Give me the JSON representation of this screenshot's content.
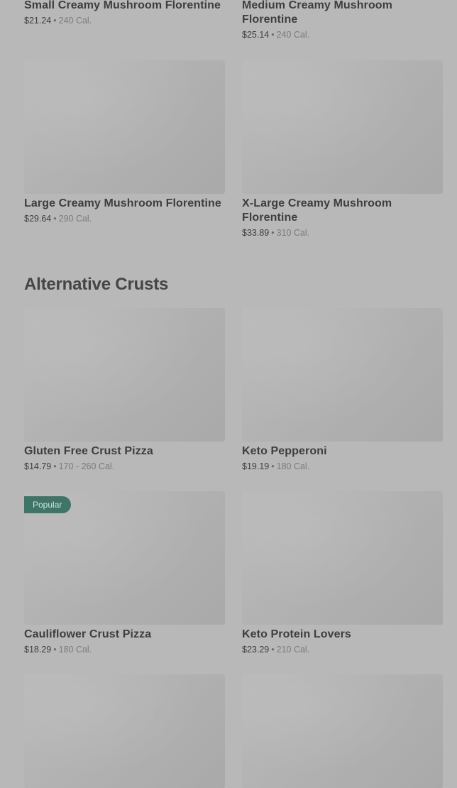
{
  "top_items": [
    {
      "name": "Small Creamy Mushroom Florentine",
      "price": "$21.24",
      "calories": "240 Cal."
    },
    {
      "name": "Medium Creamy Mushroom Florentine",
      "price": "$25.14",
      "calories": "240 Cal."
    },
    {
      "name": "Large Creamy Mushroom Florentine",
      "price": "$29.64",
      "calories": "290 Cal."
    },
    {
      "name": "X-Large Creamy Mushroom Florentine",
      "price": "$33.89",
      "calories": "310 Cal."
    }
  ],
  "section": {
    "title": "Alternative Crusts"
  },
  "alt_items": [
    {
      "name": "Gluten Free Crust Pizza",
      "price": "$14.79",
      "calories": "170 - 260 Cal."
    },
    {
      "name": "Keto Pepperoni",
      "price": "$19.19",
      "calories": "180 Cal."
    },
    {
      "name": "Cauliflower Crust Pizza",
      "price": "$18.29",
      "calories": "180 Cal.",
      "badge": "Popular"
    },
    {
      "name": "Keto Protein Lovers",
      "price": "$23.29",
      "calories": "210 Cal."
    }
  ],
  "separator": "•",
  "colors": {
    "page_background": "#b8b8b8",
    "badge_background": "#3f7567",
    "title_text": "#3e3e3e",
    "secondary_text": "#6f6f6f"
  }
}
